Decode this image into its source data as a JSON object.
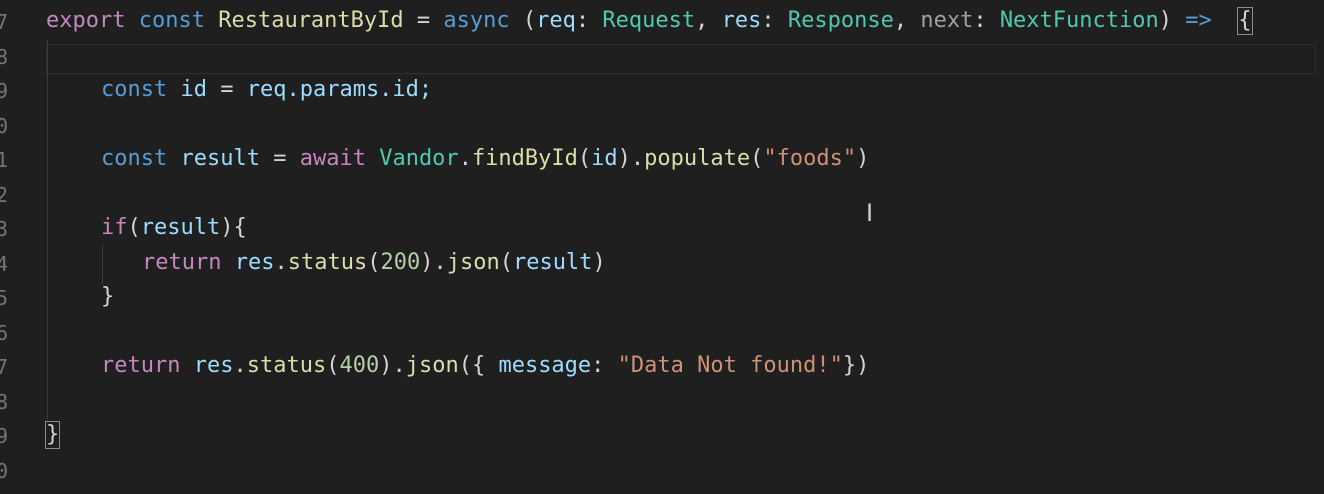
{
  "gutter": {
    "line_numbers": [
      "7",
      "8",
      "9",
      "0",
      "1",
      "2",
      "3",
      "4",
      "5",
      "6",
      "7",
      "8",
      "9",
      "0"
    ]
  },
  "code": {
    "line1": {
      "export": "export",
      "const": "const",
      "name": "RestaurantById",
      "eq": "=",
      "async": "async",
      "open": "(",
      "req": "req",
      "colon1": ":",
      "Request": "Request",
      "comma1": ",",
      "res": "res",
      "colon2": ":",
      "Response": "Response",
      "comma2": ",",
      "next": "next",
      "colon3": ":",
      "NextFunction": "NextFunction",
      "close": ")",
      "arrow": "=>",
      "brace": "{"
    },
    "line3": {
      "const": "const",
      "id": "id",
      "eq": "=",
      "expr": "req.params.id;"
    },
    "line5": {
      "const": "const",
      "result": "result",
      "eq": "=",
      "await": "await",
      "Vandor": "Vandor",
      "dot1": ".",
      "findById": "findById",
      "p1": "(",
      "id": "id",
      "p2": ").",
      "populate": "populate",
      "p3": "(",
      "foods": "\"foods\"",
      "p4": ")"
    },
    "line7": {
      "if": "if",
      "p1": "(",
      "result": "result",
      "p2": "){"
    },
    "line8": {
      "return": "return",
      "res": "res",
      "dot": ".",
      "status": "status",
      "p1": "(",
      "num": "200",
      "p2": ").",
      "json": "json",
      "p3": "(",
      "result": "result",
      "p4": ")"
    },
    "line9": {
      "brace": "}"
    },
    "line11": {
      "return": "return",
      "res": "res",
      "dot": ".",
      "status": "status",
      "p1": "(",
      "num": "400",
      "p2": ").",
      "json": "json",
      "p3": "({",
      "message": "message",
      "colon": ":",
      "str": "\"Data Not found!\"",
      "p4": "})"
    },
    "line13": {
      "brace": "}"
    }
  },
  "colors": {
    "background": "#1f1f1f",
    "keyword": "#569cd6",
    "control": "#c586c0",
    "variable": "#9cdcfe",
    "type": "#4ec9b0",
    "function": "#dcdcaa",
    "string": "#ce9178",
    "number": "#b5cea8"
  },
  "cursor": {
    "glyph": "I"
  }
}
